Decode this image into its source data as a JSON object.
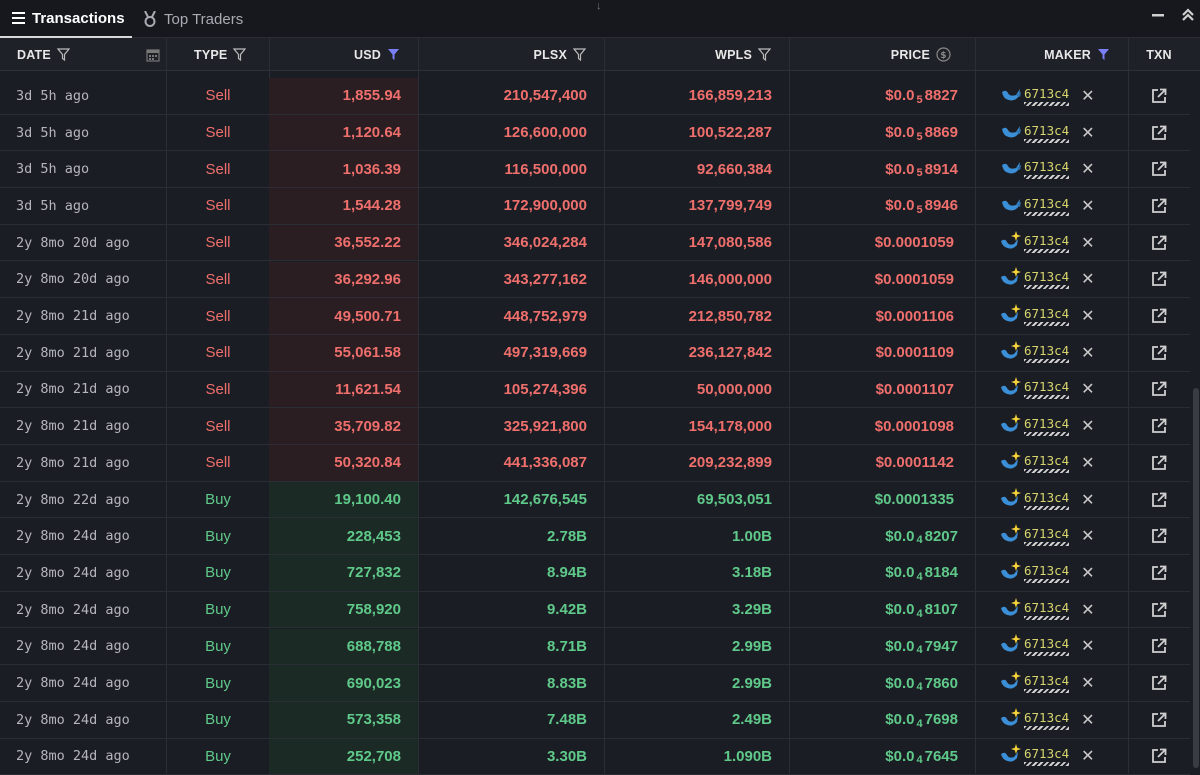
{
  "tabs": [
    {
      "label": "Transactions",
      "icon": "list-icon",
      "active": true
    },
    {
      "label": "Top Traders",
      "icon": "medal-icon",
      "active": false
    }
  ],
  "columns": {
    "date": "DATE",
    "type": "TYPE",
    "usd": "USD",
    "plsx": "PLSX",
    "wpls": "WPLS",
    "price": "PRICE",
    "maker": "MAKER",
    "txn": "TXN"
  },
  "colors": {
    "sell": "#ef6f6c",
    "buy": "#5fc98a",
    "filter_active": "#7b7ff5",
    "maker_addr": "#d7d56e"
  },
  "rows": [
    {
      "date": "3d 5h ago",
      "type": "Sell",
      "usd": "1,855.94",
      "plsx": "210,547,400",
      "wpls": "166,859,213",
      "price_pre": "$0.0",
      "price_sub": "5",
      "price_post": "8827",
      "maker": "6713c4",
      "maker_icon": "whale"
    },
    {
      "date": "3d 5h ago",
      "type": "Sell",
      "usd": "1,120.64",
      "plsx": "126,600,000",
      "wpls": "100,522,287",
      "price_pre": "$0.0",
      "price_sub": "5",
      "price_post": "8869",
      "maker": "6713c4",
      "maker_icon": "whale"
    },
    {
      "date": "3d 5h ago",
      "type": "Sell",
      "usd": "1,036.39",
      "plsx": "116,500,000",
      "wpls": "92,660,384",
      "price_pre": "$0.0",
      "price_sub": "5",
      "price_post": "8914",
      "maker": "6713c4",
      "maker_icon": "whale"
    },
    {
      "date": "3d 5h ago",
      "type": "Sell",
      "usd": "1,544.28",
      "plsx": "172,900,000",
      "wpls": "137,799,749",
      "price_pre": "$0.0",
      "price_sub": "5",
      "price_post": "8946",
      "maker": "6713c4",
      "maker_icon": "whale"
    },
    {
      "date": "2y 8mo 20d ago",
      "type": "Sell",
      "usd": "36,552.22",
      "plsx": "346,024,284",
      "wpls": "147,080,586",
      "price_pre": "$0.0001059",
      "price_sub": "",
      "price_post": "",
      "maker": "6713c4",
      "maker_icon": "whale-sparkle"
    },
    {
      "date": "2y 8mo 20d ago",
      "type": "Sell",
      "usd": "36,292.96",
      "plsx": "343,277,162",
      "wpls": "146,000,000",
      "price_pre": "$0.0001059",
      "price_sub": "",
      "price_post": "",
      "maker": "6713c4",
      "maker_icon": "whale-sparkle"
    },
    {
      "date": "2y 8mo 21d ago",
      "type": "Sell",
      "usd": "49,500.71",
      "plsx": "448,752,979",
      "wpls": "212,850,782",
      "price_pre": "$0.0001106",
      "price_sub": "",
      "price_post": "",
      "maker": "6713c4",
      "maker_icon": "whale-sparkle"
    },
    {
      "date": "2y 8mo 21d ago",
      "type": "Sell",
      "usd": "55,061.58",
      "plsx": "497,319,669",
      "wpls": "236,127,842",
      "price_pre": "$0.0001109",
      "price_sub": "",
      "price_post": "",
      "maker": "6713c4",
      "maker_icon": "whale-sparkle"
    },
    {
      "date": "2y 8mo 21d ago",
      "type": "Sell",
      "usd": "11,621.54",
      "plsx": "105,274,396",
      "wpls": "50,000,000",
      "price_pre": "$0.0001107",
      "price_sub": "",
      "price_post": "",
      "maker": "6713c4",
      "maker_icon": "whale-sparkle"
    },
    {
      "date": "2y 8mo 21d ago",
      "type": "Sell",
      "usd": "35,709.82",
      "plsx": "325,921,800",
      "wpls": "154,178,000",
      "price_pre": "$0.0001098",
      "price_sub": "",
      "price_post": "",
      "maker": "6713c4",
      "maker_icon": "whale-sparkle"
    },
    {
      "date": "2y 8mo 21d ago",
      "type": "Sell",
      "usd": "50,320.84",
      "plsx": "441,336,087",
      "wpls": "209,232,899",
      "price_pre": "$0.0001142",
      "price_sub": "",
      "price_post": "",
      "maker": "6713c4",
      "maker_icon": "whale-sparkle"
    },
    {
      "date": "2y 8mo 22d ago",
      "type": "Buy",
      "usd": "19,100.40",
      "plsx": "142,676,545",
      "wpls": "69,503,051",
      "price_pre": "$0.0001335",
      "price_sub": "",
      "price_post": "",
      "maker": "6713c4",
      "maker_icon": "whale-sparkle"
    },
    {
      "date": "2y 8mo 24d ago",
      "type": "Buy",
      "usd": "228,453",
      "plsx": "2.78B",
      "wpls": "1.00B",
      "price_pre": "$0.0",
      "price_sub": "4",
      "price_post": "8207",
      "maker": "6713c4",
      "maker_icon": "whale-sparkle"
    },
    {
      "date": "2y 8mo 24d ago",
      "type": "Buy",
      "usd": "727,832",
      "plsx": "8.94B",
      "wpls": "3.18B",
      "price_pre": "$0.0",
      "price_sub": "4",
      "price_post": "8184",
      "maker": "6713c4",
      "maker_icon": "whale-sparkle"
    },
    {
      "date": "2y 8mo 24d ago",
      "type": "Buy",
      "usd": "758,920",
      "plsx": "9.42B",
      "wpls": "3.29B",
      "price_pre": "$0.0",
      "price_sub": "4",
      "price_post": "8107",
      "maker": "6713c4",
      "maker_icon": "whale-sparkle"
    },
    {
      "date": "2y 8mo 24d ago",
      "type": "Buy",
      "usd": "688,788",
      "plsx": "8.71B",
      "wpls": "2.99B",
      "price_pre": "$0.0",
      "price_sub": "4",
      "price_post": "7947",
      "maker": "6713c4",
      "maker_icon": "whale-sparkle"
    },
    {
      "date": "2y 8mo 24d ago",
      "type": "Buy",
      "usd": "690,023",
      "plsx": "8.83B",
      "wpls": "2.99B",
      "price_pre": "$0.0",
      "price_sub": "4",
      "price_post": "7860",
      "maker": "6713c4",
      "maker_icon": "whale-sparkle"
    },
    {
      "date": "2y 8mo 24d ago",
      "type": "Buy",
      "usd": "573,358",
      "plsx": "7.48B",
      "wpls": "2.49B",
      "price_pre": "$0.0",
      "price_sub": "4",
      "price_post": "7698",
      "maker": "6713c4",
      "maker_icon": "whale-sparkle"
    },
    {
      "date": "2y 8mo 24d ago",
      "type": "Buy",
      "usd": "252,708",
      "plsx": "3.30B",
      "wpls": "1.090B",
      "price_pre": "$0.0",
      "price_sub": "4",
      "price_post": "7645",
      "maker": "6713c4",
      "maker_icon": "whale-sparkle"
    }
  ]
}
